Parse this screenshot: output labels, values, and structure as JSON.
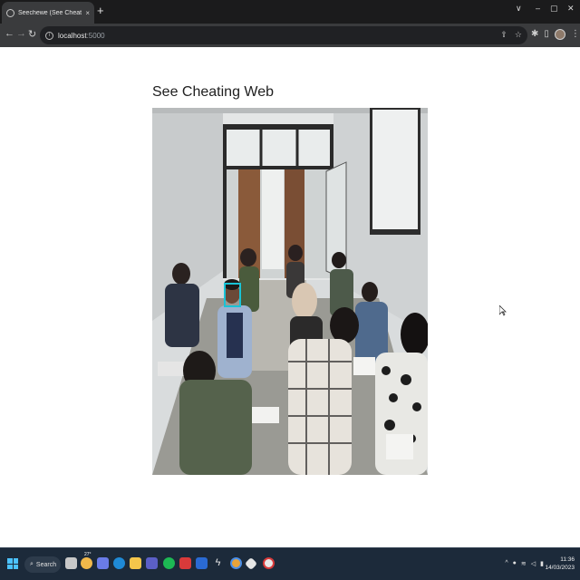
{
  "browser": {
    "tab_title": "Seechewe (See Cheating Web)",
    "tab_close": "×",
    "new_tab": "+",
    "window_controls": {
      "dropdown": "∨",
      "minimize": "–",
      "maximize": "▢",
      "close": "✕"
    },
    "url_host": "localhost",
    "url_port": ":5000",
    "info_glyph": "i",
    "nav": {
      "back": "←",
      "forward": "→",
      "reload": "↻"
    }
  },
  "page": {
    "heading": "See Cheating Web"
  },
  "detection": {
    "box_color": "#19c3d6"
  },
  "taskbar": {
    "search_label": "Search",
    "weather_temp": "27°",
    "time": "11:36",
    "date": "14/03/2023",
    "tray_chevron": "^"
  },
  "colors": {
    "tabstrip": "#1b1b1c",
    "toolbar": "#3a3b3d",
    "taskbar": "#1c2a3a",
    "accent": "#4cc2ff"
  }
}
